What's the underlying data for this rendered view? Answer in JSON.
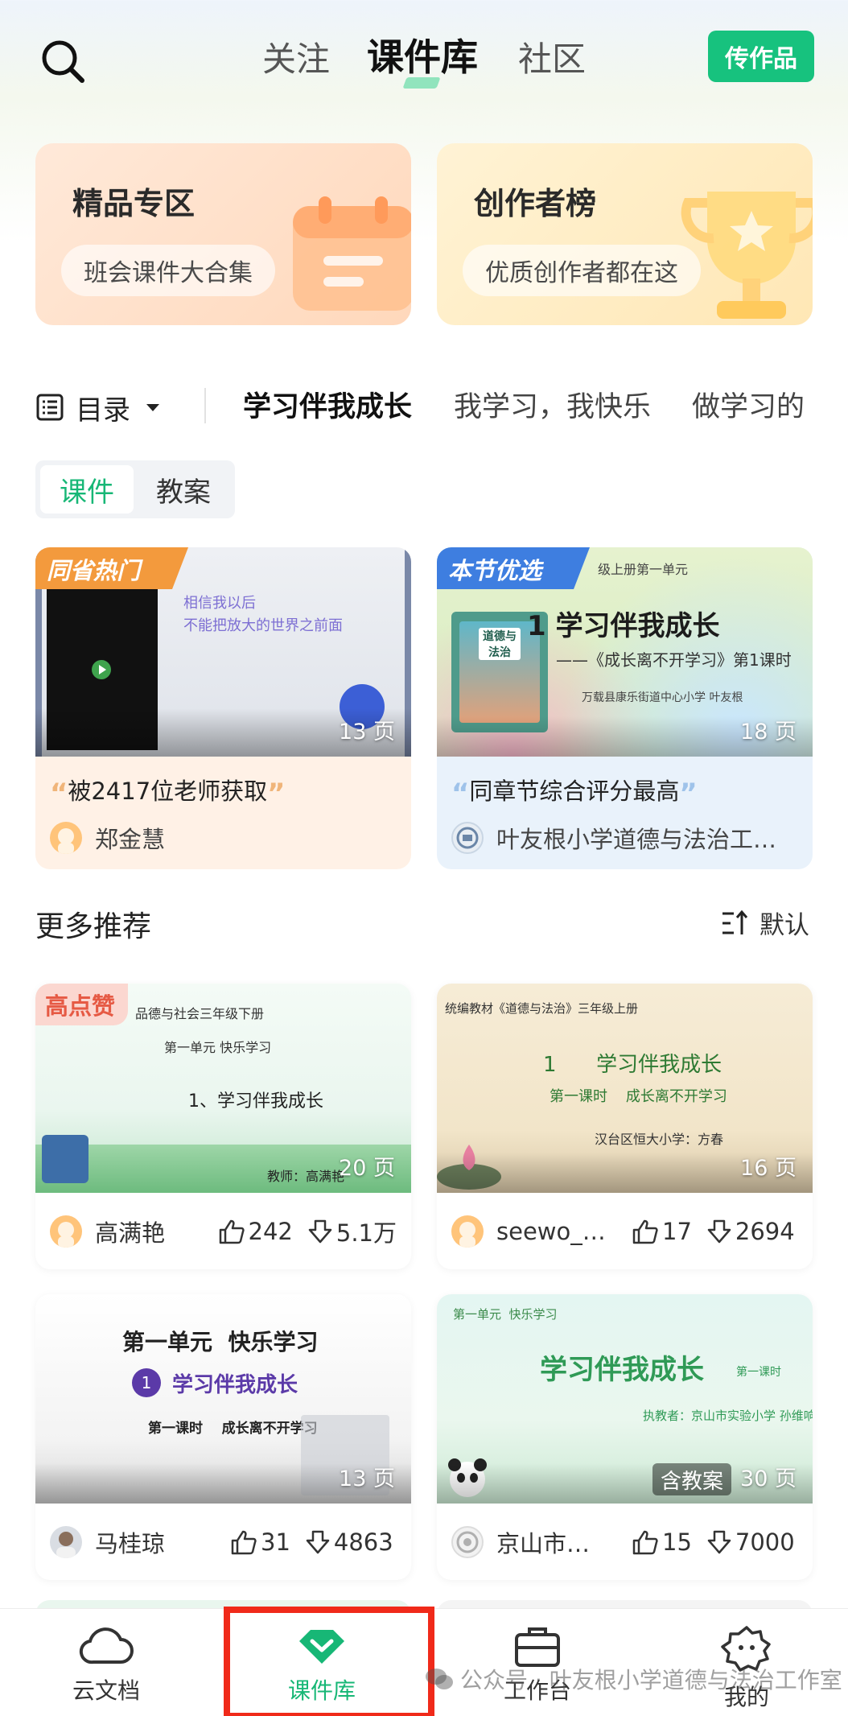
{
  "header": {
    "tabs": [
      "关注",
      "课件库",
      "社区"
    ],
    "active_tab": "课件库",
    "upload_button": "传作品",
    "accent_color": "#17c27e"
  },
  "banners": [
    {
      "title": "精品专区",
      "subtitle": "班会课件大合集"
    },
    {
      "title": "创作者榜",
      "subtitle": "优质创作者都在这"
    }
  ],
  "catalog": {
    "label": "目录",
    "chapters": [
      "学习伴我成长",
      "我学习，我快乐",
      "做学习的"
    ]
  },
  "segment": {
    "options": [
      "课件",
      "教案"
    ],
    "selected": "课件"
  },
  "featured": [
    {
      "badge": "同省热门",
      "pages": "13 页",
      "quote": "被2417位老师获取",
      "author": "郑金慧",
      "thumb_lines": [
        "相信我以后",
        "不能把放大的世界之前面"
      ]
    },
    {
      "badge": "本节优选",
      "pages": "18 页",
      "quote": "同章节综合评分最高",
      "author": "叶友根小学道德与法治工…",
      "thumb_header": "级上册第一单元",
      "thumb_title": "1  学习伴我成长",
      "thumb_subtitle": "——《成长离不开学习》第1课时",
      "thumb_school": "万载县康乐街道中心小学  叶友根",
      "book_label": "道德与法治"
    }
  ],
  "more": {
    "title": "更多推荐",
    "sort_label": "默认"
  },
  "courses": [
    {
      "badge": "高点赞",
      "pages": "20 页",
      "author": "高满艳",
      "likes": "242",
      "downloads": "5.1万",
      "thumb_lines": [
        "品德与社会三年级下册",
        "第一单元  快乐学习",
        "1、学习伴我成长",
        "教师：高满艳"
      ]
    },
    {
      "pages": "16 页",
      "author": "seewo_…",
      "likes": "17",
      "downloads": "2694",
      "thumb_lines": [
        "统编教材《道德与法治》三年级上册",
        "1      学习伴我成长",
        "第一课时    成长离不开学习",
        "汉台区恒大小学：方春"
      ]
    },
    {
      "pages": "13 页",
      "author": "马桂琼",
      "likes": "31",
      "downloads": "4863",
      "thumb_lines": [
        "第一单元  快乐学习",
        "1",
        "学习伴我成长",
        "第一课时    成长离不开学习"
      ]
    },
    {
      "pages": "30 页",
      "tag": "含教案",
      "author": "京山市…",
      "likes": "15",
      "downloads": "7000",
      "thumb_lines": [
        "第一单元  快乐学习",
        "学习伴我成长",
        "第一课时",
        "执教者：京山市实验小学  孙维响"
      ]
    }
  ],
  "bottom_nav": [
    {
      "label": "云文档",
      "icon": "cloud-icon"
    },
    {
      "label": "课件库",
      "icon": "courseware-icon",
      "active": true
    },
    {
      "label": "工作台",
      "icon": "briefcase-icon"
    },
    {
      "label": "我的",
      "icon": "profile-icon"
    }
  ],
  "watermark": "公众号 · 叶友根小学道德与法治工作室"
}
